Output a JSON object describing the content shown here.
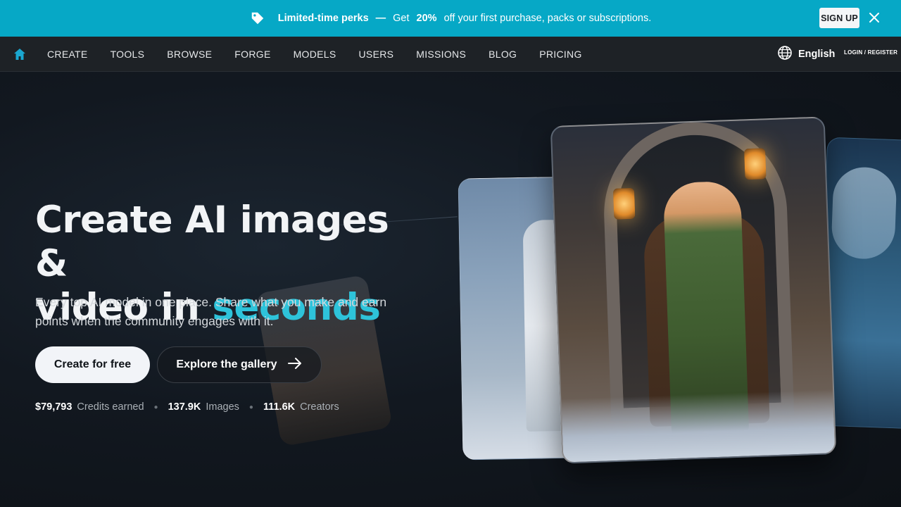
{
  "promo": {
    "strong": "Limited-time perks",
    "dash": "—",
    "get": "Get",
    "percent": "20%",
    "rest": "off your first purchase, packs or subscriptions.",
    "signup": "SIGN UP",
    "tag_icon": "tag-icon",
    "close_icon": "close-icon"
  },
  "nav": {
    "home_icon": "home-icon",
    "links": [
      "CREATE",
      "TOOLS",
      "BROWSE",
      "FORGE",
      "MODELS",
      "USERS",
      "MISSIONS",
      "BLOG",
      "PRICING"
    ],
    "language": "English",
    "globe_icon": "globe-icon",
    "login": "LOGIN / REGISTER"
  },
  "hero": {
    "headline_line1": "Create AI images &",
    "headline_line2_prefix": "video in",
    "headline_accent": "seconds",
    "subtitle": "Every top AI model in one place. Share what you make and earn points when the community engages with it.",
    "cta_primary": "Create for free",
    "cta_secondary": "Explore the gallery",
    "arrow_icon": "arrow-right-icon",
    "stats": [
      {
        "value": "$79,793",
        "label": "Credits earned"
      },
      {
        "value": "137.9K",
        "label": "Images"
      },
      {
        "value": "111.6K",
        "label": "Creators"
      }
    ]
  },
  "colors": {
    "banner": "#06a8c6",
    "accent": "#2ec3da",
    "nav_bg": "#1e2226",
    "home_icon": "#1aa7d0"
  }
}
